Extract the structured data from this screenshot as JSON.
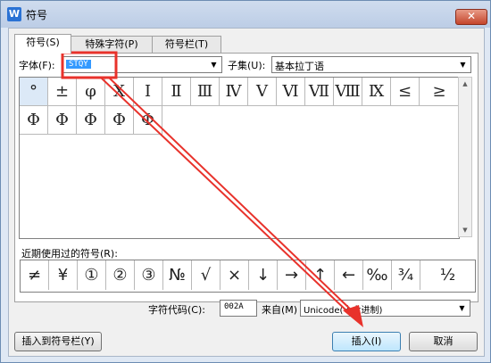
{
  "window": {
    "title": "符号",
    "app_icon_letter": "W",
    "close_symbol": "✕"
  },
  "tabs": [
    {
      "label": "符号(S)"
    },
    {
      "label": "特殊字符(P)"
    },
    {
      "label": "符号栏(T)"
    }
  ],
  "font": {
    "label": "字体(F):",
    "value": "STQY"
  },
  "subset": {
    "label": "子集(U):",
    "value": "基本拉丁语"
  },
  "symbol_grid": [
    "°",
    "±",
    "φ",
    "Ⅹ",
    "Ⅰ",
    "Ⅱ",
    "Ⅲ",
    "Ⅳ",
    "Ⅴ",
    "Ⅵ",
    "Ⅶ",
    "Ⅷ",
    "Ⅸ",
    "≤",
    "≥",
    "Φ",
    "Φ",
    "Φ",
    "Φ",
    "Φ"
  ],
  "recent": {
    "label": "近期使用过的符号(R):",
    "symbols": [
      "≠",
      "¥",
      "①",
      "②",
      "③",
      "№",
      "√",
      "×",
      "↓",
      "→",
      "↑",
      "←",
      "‰",
      "¾",
      "½"
    ]
  },
  "code": {
    "label": "字符代码(C):",
    "value": "002A"
  },
  "from": {
    "label": "来自(M)",
    "value": "Unicode(十六进制)"
  },
  "buttons": {
    "insert_to_bar": "插入到符号栏(Y)",
    "insert": "插入(I)",
    "cancel": "取消"
  },
  "annotation": {
    "color": "#e8322b"
  }
}
